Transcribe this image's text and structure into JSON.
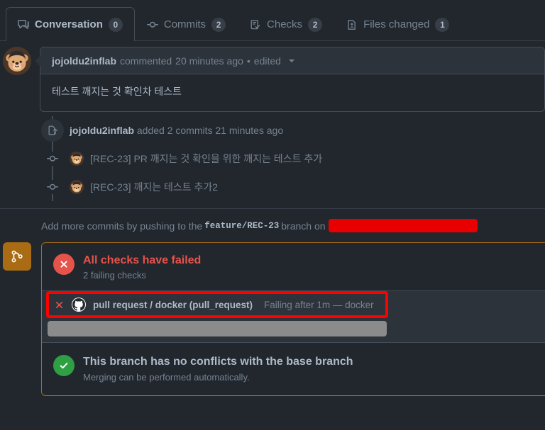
{
  "tabs": [
    {
      "id": "conversation",
      "label": "Conversation",
      "count": "0",
      "icon": "comment-discussion-icon",
      "selected": true
    },
    {
      "id": "commits",
      "label": "Commits",
      "count": "2",
      "icon": "git-commit-icon",
      "selected": false
    },
    {
      "id": "checks",
      "label": "Checks",
      "count": "2",
      "icon": "checklist-icon",
      "selected": false
    },
    {
      "id": "files-changed",
      "label": "Files changed",
      "count": "1",
      "icon": "file-diff-icon",
      "selected": false
    }
  ],
  "comment": {
    "author": "jojoldu2inflab",
    "action": "commented",
    "timestamp": "20 minutes ago",
    "separator": "•",
    "edited": "edited",
    "body": "테스트 깨지는 것 확인차 테스트"
  },
  "timeline": {
    "push_event": {
      "author": "jojoldu2inflab",
      "text": "added 2 commits 21 minutes ago"
    },
    "commits": [
      {
        "message": "[REC-23] PR 깨지는 것 확인을 위한 깨지는 테스트 추가"
      },
      {
        "message": "[REC-23] 깨지는 테스트 추가2"
      }
    ]
  },
  "push_hint": {
    "prefix": "Add more commits by pushing to the",
    "branch": "feature/REC-23",
    "suffix": "branch on",
    "redacted": true
  },
  "merge_status": {
    "checks": {
      "title": "All checks have failed",
      "subtitle": "2 failing checks",
      "status": "failure"
    },
    "check_rows": [
      {
        "name": "pull request / docker (pull_request)",
        "description": "Failing after 1m — docker",
        "status": "failure",
        "highlighted": true
      }
    ],
    "redacted_row": true,
    "conflicts": {
      "title": "This branch has no conflicts with the base branch",
      "subtitle": "Merging can be performed automatically.",
      "status": "success"
    }
  },
  "colors": {
    "page_bg": "#22272e",
    "surface": "#2d333b",
    "border": "#444c56",
    "text": "#adbac7",
    "muted": "#768390",
    "danger": "#e5534b",
    "success": "#2ea043",
    "attention": "#a96c15",
    "redact_red": "#e80000",
    "redact_gray": "#8b8b8b",
    "highlight_red": "#ff0000"
  }
}
